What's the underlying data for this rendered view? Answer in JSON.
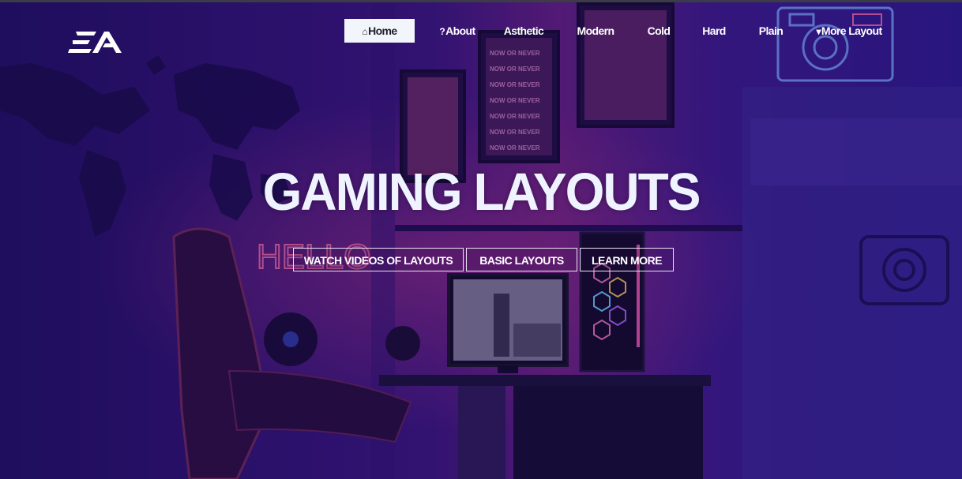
{
  "brand": {
    "logo_text": "EA"
  },
  "nav": {
    "items": [
      {
        "label": "Home",
        "icon": "home-icon",
        "active": true
      },
      {
        "label": "About",
        "icon": "question-icon"
      },
      {
        "label": "Asthetic"
      },
      {
        "label": "Modern"
      },
      {
        "label": "Cold"
      },
      {
        "label": "Hard"
      },
      {
        "label": "Plain"
      },
      {
        "label": "More Layout",
        "icon": "caret-down-icon"
      }
    ]
  },
  "hero": {
    "title": "GAMING LAYOUTS",
    "buttons": [
      {
        "label": "WATCH VIDEOS OF LAYOUTS"
      },
      {
        "label": "BASIC LAYOUTS"
      },
      {
        "label": "LEARN MORE"
      }
    ]
  },
  "scene": {
    "neon_sign_text": "HELLO",
    "poster_text": "NOW OR NEVER"
  },
  "colors": {
    "overlay": "#2a0f6e",
    "nav_active_bg": "#f2f6fb",
    "neon_pink": "#ff6fa8",
    "neon_blue": "#4aa8ff"
  }
}
